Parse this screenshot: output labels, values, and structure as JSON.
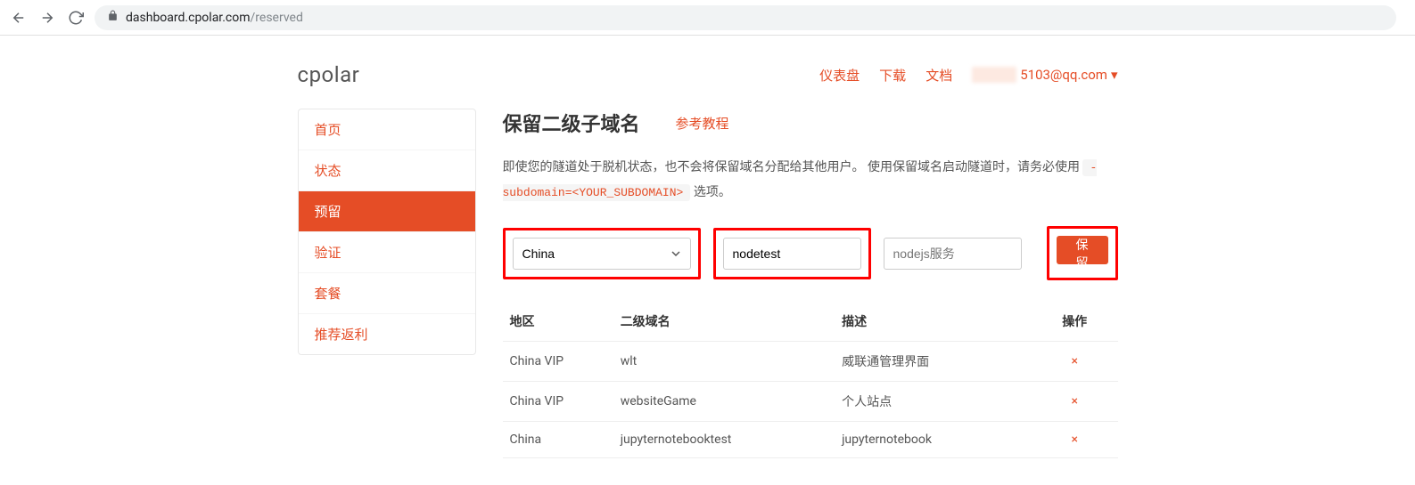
{
  "browser": {
    "url_host": "dashboard.cpolar.com",
    "url_path": "/reserved"
  },
  "header": {
    "logo": "cpolar",
    "nav": {
      "dashboard": "仪表盘",
      "download": "下载",
      "docs": "文档",
      "email_suffix": "5103@qq.com",
      "caret": "▾"
    }
  },
  "sidebar": {
    "items": [
      {
        "label": "首页",
        "active": false
      },
      {
        "label": "状态",
        "active": false
      },
      {
        "label": "预留",
        "active": true
      },
      {
        "label": "验证",
        "active": false
      },
      {
        "label": "套餐",
        "active": false
      },
      {
        "label": "推荐返利",
        "active": false
      }
    ]
  },
  "main": {
    "title": "保留二级子域名",
    "tutorial": "参考教程",
    "desc_part1": "即使您的隧道处于脱机状态，也不会将保留域名分配给其他用户。 使用保留域名启动隧道时，请务必使用 ",
    "desc_code": "-subdomain=<YOUR_SUBDOMAIN>",
    "desc_part2": " 选项。",
    "form": {
      "region_value": "China",
      "subdomain_value": "nodetest",
      "desc_placeholder": "nodejs服务",
      "submit_label": "保留"
    },
    "table": {
      "headers": {
        "region": "地区",
        "subdomain": "二级域名",
        "desc": "描述",
        "ops": "操作"
      },
      "rows": [
        {
          "region": "China VIP",
          "subdomain": "wlt",
          "desc": "威联通管理界面"
        },
        {
          "region": "China VIP",
          "subdomain": "websiteGame",
          "desc": "个人站点"
        },
        {
          "region": "China",
          "subdomain": "jupyternotebooktest",
          "desc": "jupyternotebook"
        }
      ],
      "delete_glyph": "×"
    }
  }
}
